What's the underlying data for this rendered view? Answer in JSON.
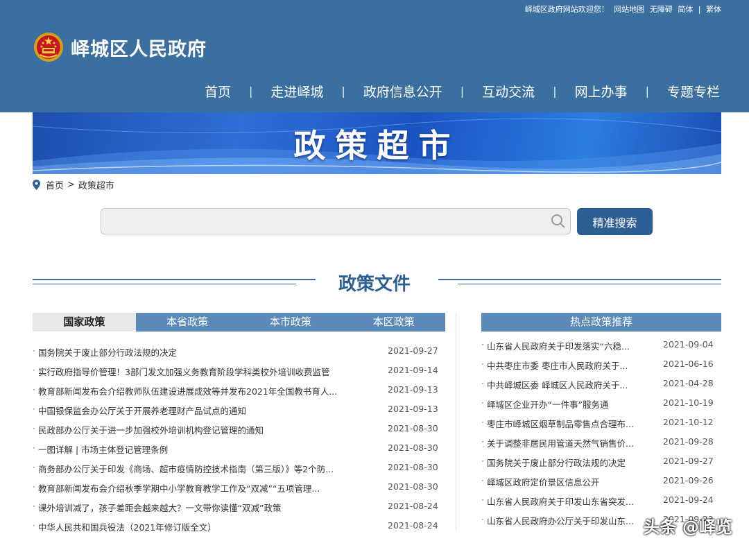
{
  "header": {
    "top_links": [
      "峄城区政府网站欢迎您！",
      "网站地图",
      "无障碍",
      "简体",
      "|",
      "繁体"
    ],
    "site_title": "峄城区人民政府",
    "nav": [
      "首页",
      "走进峄城",
      "政府信息公开",
      "互动交流",
      "网上办事",
      "专题专栏"
    ],
    "nav_separator": "|"
  },
  "banner": {
    "title": "政策超市"
  },
  "breadcrumb": {
    "home": "首页",
    "separator": ">",
    "current": "政策超市"
  },
  "search": {
    "value": "",
    "button_label": "精准搜索"
  },
  "section": {
    "title": "政策文件"
  },
  "tabs": [
    {
      "label": "国家政策",
      "active": true
    },
    {
      "label": "本省政策",
      "active": false
    },
    {
      "label": "本市政策",
      "active": false
    },
    {
      "label": "本区政策",
      "active": false
    }
  ],
  "policy_list": [
    {
      "title": "国务院关于废止部分行政法规的决定",
      "date": "2021-09-27"
    },
    {
      "title": "实行政府指导价管理！3部门发文加强义务教育阶段学科类校外培训收费监管",
      "date": "2021-09-14"
    },
    {
      "title": "教育部新闻发布会介绍教师队伍建设进展成效等并发布2021年全国教书育人...",
      "date": "2021-09-13"
    },
    {
      "title": "中国银保监会办公厅关于开展养老理财产品试点的通知",
      "date": "2021-09-13"
    },
    {
      "title": "民政部办公厅关于进一步加强校外培训机构登记管理的通知",
      "date": "2021-08-30"
    },
    {
      "title": "一图详解 | 市场主体登记管理条例",
      "date": "2021-08-30"
    },
    {
      "title": "商务部办公厅关于印发《商场、超市疫情防控技术指南（第三版）》等2个防...",
      "date": "2021-08-30"
    },
    {
      "title": "教育部新闻发布会介绍秋季学期中小学教育教学工作及“双减”“五项管理...",
      "date": "2021-08-30"
    },
    {
      "title": "课外培训减了，孩子差距会越来越大？一文带你读懂“双减”政策",
      "date": "2021-08-24"
    },
    {
      "title": "中华人民共和国兵役法（2021年修订版全文）",
      "date": "2021-08-24"
    }
  ],
  "hot": {
    "title": "热点政策推荐",
    "items": [
      {
        "title": "山东省人民政府关于印发落实“六稳...",
        "date": "2021-09-04"
      },
      {
        "title": "中共枣庄市委 枣庄市人民政府关于...",
        "date": "2021-06-16"
      },
      {
        "title": "中共峄城区委 峄城区人民政府关于...",
        "date": "2021-04-28"
      },
      {
        "title": "峄城区企业开办“一件事”服务通",
        "date": "2021-10-19"
      },
      {
        "title": "枣庄市峄城区烟草制品零售点合理布...",
        "date": "2021-10-12"
      },
      {
        "title": "关于调整非居民用管道天然气销售价...",
        "date": "2021-09-28"
      },
      {
        "title": "国务院关于废止部分行政法规的决定",
        "date": "2021-09-27"
      },
      {
        "title": "峄城区政府定价景区信息公开",
        "date": "2021-09-26"
      },
      {
        "title": "山东省人民政府关于印发山东省突发...",
        "date": "2021-09-24"
      },
      {
        "title": "山东省人民政府办公厅关于印发山东...",
        "date": "2021-09-23"
      }
    ]
  },
  "watermark": "头条 @峄览",
  "colors": {
    "header_bg": "#3a6fa0",
    "tab_bg": "#5b8ab8",
    "button_bg": "#2d5f95"
  }
}
